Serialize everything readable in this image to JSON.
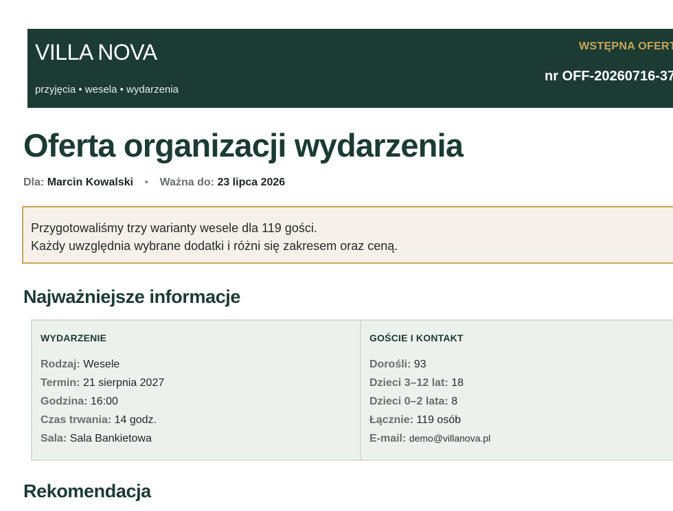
{
  "header": {
    "brand": "VILLA NOVA",
    "tagline": "przyjęcia • wesela • wydarzenia",
    "offer_kind": "WSTĘPNA OFERTA",
    "offer_number": "nr OFF-20260716-37"
  },
  "title": "Oferta organizacji wydarzenia",
  "meta": {
    "for_label": "Dla:",
    "for_value": "Marcin Kowalski",
    "separator": "•",
    "valid_label": "Ważna do:",
    "valid_value": "23 lipca 2026"
  },
  "intro": {
    "line1": "Przygotowaliśmy trzy warianty wesele dla 119 gości.",
    "line2": "Każdy uwzględnia wybrane dodatki i różni się zakresem oraz ceną."
  },
  "sections": {
    "info_heading": "Najważniejsze informacje",
    "recommendation_heading": "Rekomendacja"
  },
  "event": {
    "heading": "WYDARZENIE",
    "rows": [
      {
        "label": "Rodzaj:",
        "value": "Wesele"
      },
      {
        "label": "Termin:",
        "value": "21 sierpnia 2027"
      },
      {
        "label": "Godzina:",
        "value": "16:00"
      },
      {
        "label": "Czas trwania:",
        "value": "14 godz."
      },
      {
        "label": "Sala:",
        "value": "Sala Bankietowa"
      }
    ]
  },
  "guests": {
    "heading": "GOŚCIE I KONTAKT",
    "rows": [
      {
        "label": "Dorośli:",
        "value": "93"
      },
      {
        "label": "Dzieci 3–12 lat:",
        "value": "18"
      },
      {
        "label": "Dzieci 0–2 lata:",
        "value": "8"
      },
      {
        "label": "Łącznie:",
        "value": "119 osób"
      },
      {
        "label": "E-mail:",
        "value": "demo@villanova.pl"
      }
    ]
  }
}
